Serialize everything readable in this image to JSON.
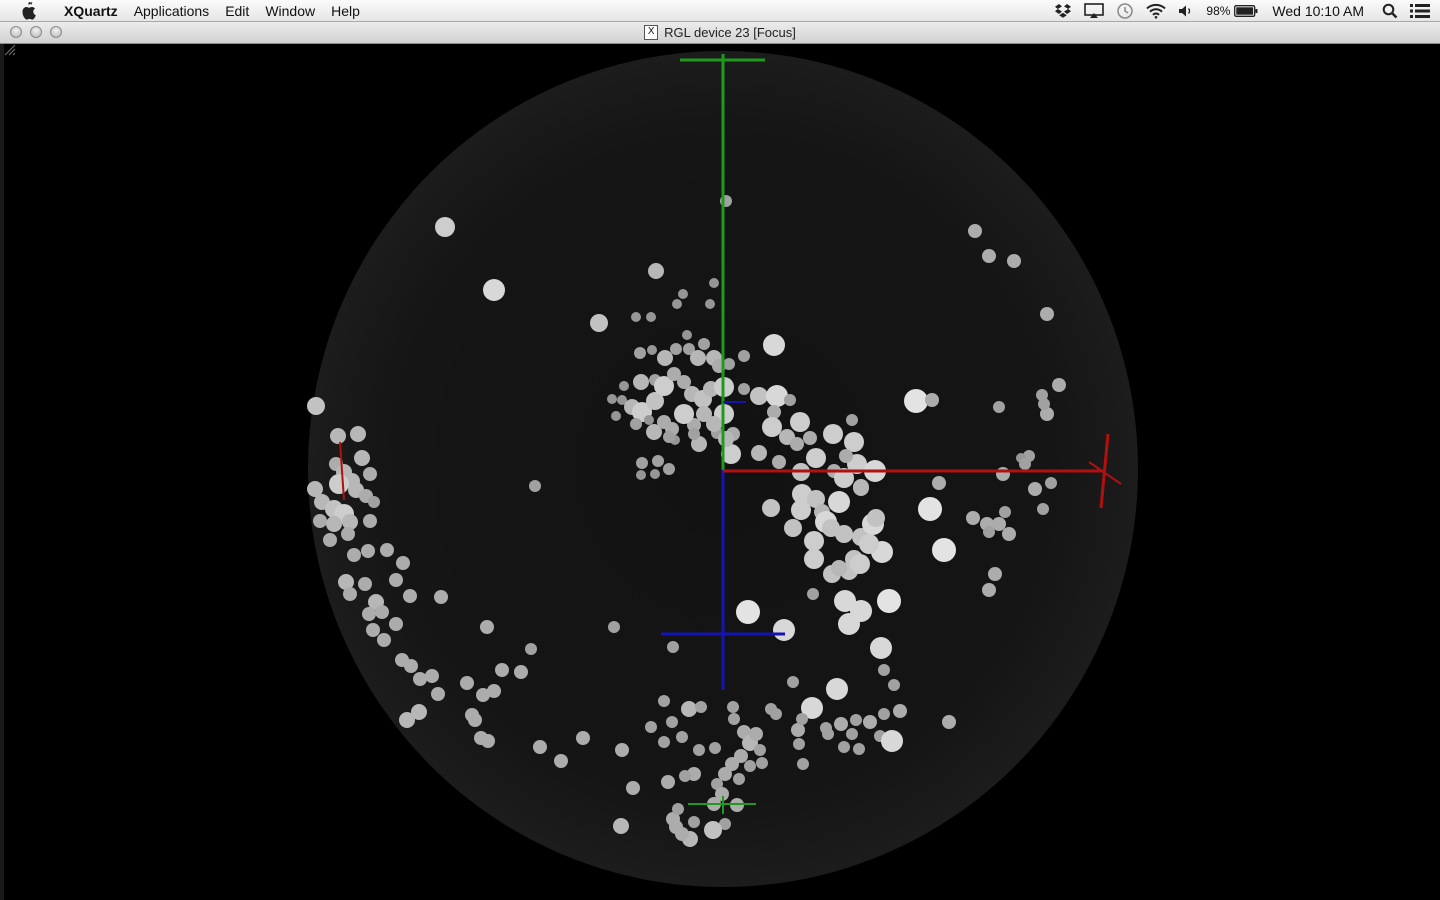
{
  "menubar": {
    "apple_icon": "apple-icon",
    "items": [
      {
        "label": "XQuartz"
      },
      {
        "label": "Applications"
      },
      {
        "label": "Edit"
      },
      {
        "label": "Window"
      },
      {
        "label": "Help"
      }
    ],
    "tray_icons": [
      "dropbox-icon",
      "airplay-icon",
      "time-machine-icon",
      "wifi-icon",
      "volume-icon"
    ],
    "battery_percent": "98%",
    "battery_icon": "battery-icon",
    "clock": "Wed 10:10 AM",
    "spotlight_icon": "search-icon",
    "notification_icon": "list-icon"
  },
  "window": {
    "title": "RGL device 23 [Focus]",
    "app_icon": "x11-icon",
    "app_icon_glyph": "X"
  },
  "scene": {
    "background": "#000000",
    "sphere_color": "#141414",
    "axis_colors": {
      "x": "#b01010",
      "y": "#1f9a1f",
      "z": "#1414b4"
    },
    "point_color": "#d8d8d8"
  }
}
